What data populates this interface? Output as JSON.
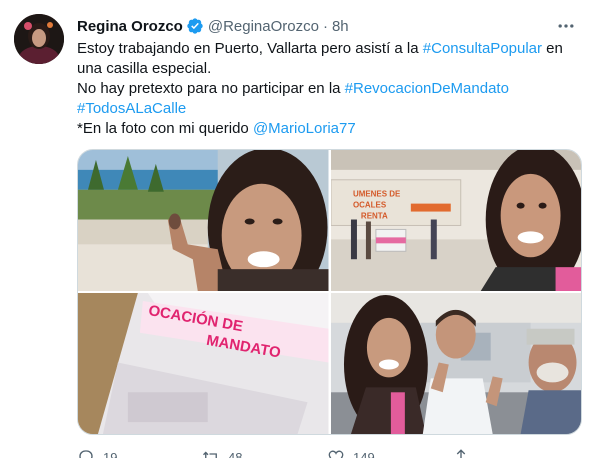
{
  "author": {
    "name": "Regina Orozco",
    "handle": "@ReginaOrozco",
    "separator": "·",
    "time": "8h"
  },
  "tweet_text": {
    "line1_prefix": "Estoy trabajando en Puerto, Vallarta pero asistí a la ",
    "line1_hashtag": "#ConsultaPopular",
    "line1_suffix": " en",
    "line2": "una casilla especial.",
    "line3_prefix": "No hay pretexto para no participar en la ",
    "line3_hashtag": "#RevocacionDeMandato",
    "line4_hashtag": "#TodosALaCalle",
    "line5_prefix": "*En la foto con mi querido ",
    "line5_mention": "@MarioLoria77"
  },
  "media": {
    "ballot_text_line1": "OCACIÓN DE",
    "ballot_text_line2": "MANDATO",
    "booth_sign_line1": "UMENES DE",
    "booth_sign_line2": "OCALES",
    "booth_sign_line3": "RENTA"
  },
  "actions": {
    "reply_count": "19",
    "retweet_count": "48",
    "like_count": "149"
  },
  "colors": {
    "link": "#1d9bf0",
    "secondary_text": "#536471",
    "verified_badge": "#1d9bf0"
  },
  "icons": [
    "verified-badge-icon",
    "more-options-icon",
    "reply-icon",
    "retweet-icon",
    "like-icon",
    "share-icon"
  ]
}
